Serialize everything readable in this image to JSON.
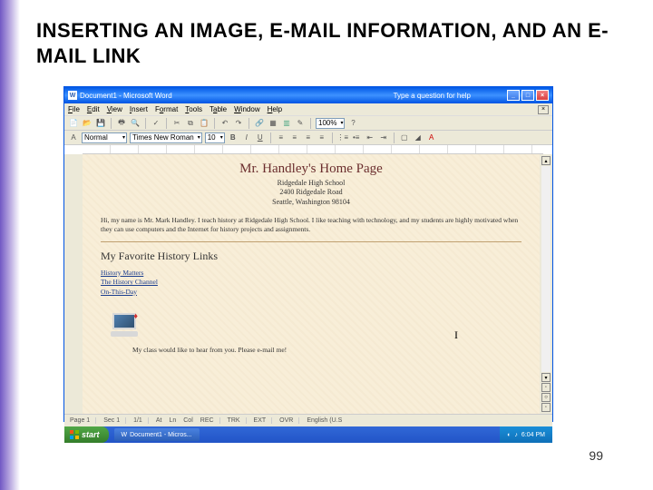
{
  "slide": {
    "title": "INSERTING AN IMAGE, E-MAIL INFORMATION, AND AN E-MAIL LINK",
    "page_number": "99"
  },
  "word": {
    "titlebar": {
      "title": "Document1 - Microsoft Word",
      "helper": "Type a question for help"
    },
    "menu": {
      "file": "File",
      "edit": "Edit",
      "view": "View",
      "insert": "Insert",
      "format": "Format",
      "tools": "Tools",
      "table": "Table",
      "window": "Window",
      "help": "Help"
    },
    "toolbar2": {
      "style": "Normal",
      "font": "Times New Roman",
      "size": "10",
      "bold": "B",
      "italic": "I",
      "underline": "U",
      "zoom": "100%"
    },
    "page": {
      "title": "Mr. Handley's Home Page",
      "school": "Ridgedale High School",
      "address": "2400 Ridgedale Road",
      "city": "Seattle, Washington 98104",
      "intro": "Hi, my name is Mr. Mark Handley. I teach history at Ridgedale High School. I like teaching with technology, and my students are highly motivated when they can use computers and the Internet for history projects and assignments.",
      "section": "My Favorite History Links",
      "links": [
        "History Matters",
        "The History Channel",
        "On-This-Day"
      ],
      "mailto": "My class would like to hear from you. Please e-mail me!"
    },
    "statusbar": {
      "items": [
        "Page 1",
        "Sec 1",
        "1/1",
        "At",
        "Ln",
        "Col",
        "REC",
        "TRK",
        "EXT",
        "OVR",
        "English (U.S"
      ]
    },
    "cursor": "I"
  },
  "taskbar": {
    "start": "start",
    "task": "Document1 - Micros...",
    "time": "6:04 PM"
  }
}
